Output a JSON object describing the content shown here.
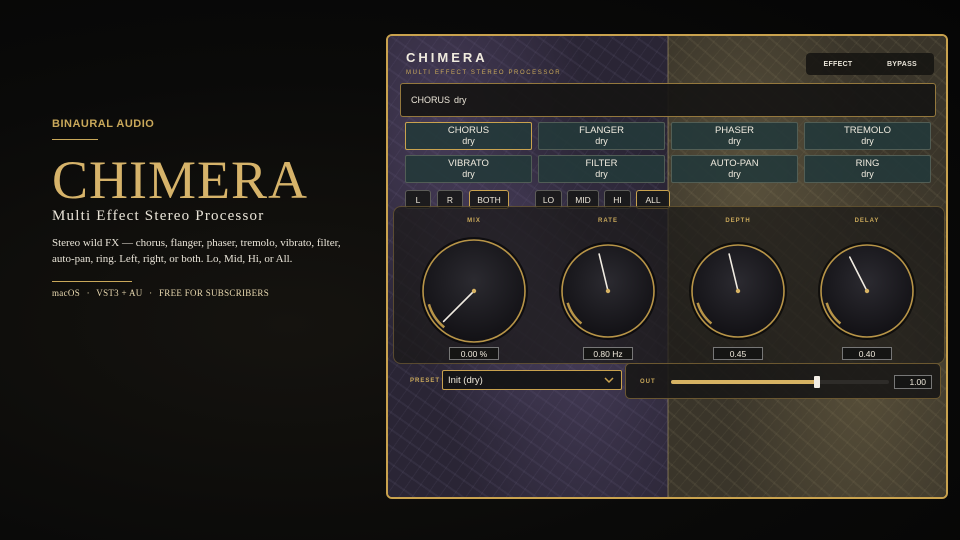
{
  "promo": {
    "brand": "BINAURAL AUDIO",
    "title": "CHIMERA",
    "subtitle": "Multi Effect Stereo Processor",
    "description": "Stereo wild FX — chorus, flanger, phaser, tremolo, vibrato, filter, auto-pan, ring. Left, right, or both. Lo, Mid, Hi, or All.",
    "meta": [
      "macOS",
      "VST3 + AU",
      "FREE FOR SUBSCRIBERS"
    ],
    "meta_separator": "·"
  },
  "plugin": {
    "title": "CHIMERA",
    "subtitle": "MULTI EFFECT STEREO PROCESSOR",
    "mode_tabs": [
      "EFFECT",
      "BYPASS"
    ],
    "status": {
      "effect": "CHORUS",
      "value": "dry"
    },
    "effects": [
      {
        "name": "CHORUS",
        "value": "dry",
        "active": true
      },
      {
        "name": "FLANGER",
        "value": "dry"
      },
      {
        "name": "PHASER",
        "value": "dry"
      },
      {
        "name": "TREMOLO",
        "value": "dry"
      },
      {
        "name": "VIBRATO",
        "value": "dry"
      },
      {
        "name": "FILTER",
        "value": "dry"
      },
      {
        "name": "AUTO-PAN",
        "value": "dry"
      },
      {
        "name": "RING",
        "value": "dry"
      }
    ],
    "channels": [
      "L",
      "R",
      "BOTH"
    ],
    "channel_selected": "BOTH",
    "bands": [
      "LO",
      "MID",
      "HI",
      "ALL"
    ],
    "band_selected": "ALL",
    "knobs": [
      {
        "label": "MIX",
        "value": "0.00 %",
        "level": 0.0
      },
      {
        "label": "RATE",
        "value": "0.80 Hz",
        "level": 0.45
      },
      {
        "label": "DEPTH",
        "value": "0.45",
        "level": 0.45
      },
      {
        "label": "DELAY",
        "value": "0.40",
        "level": 0.4
      }
    ],
    "preset": {
      "label": "PRESET",
      "value": "Init (dry)"
    },
    "output": {
      "label": "OUT",
      "value": "1.00",
      "level": 0.67
    },
    "colors": {
      "accent": "#c9a24e",
      "button": "#24383a"
    }
  }
}
